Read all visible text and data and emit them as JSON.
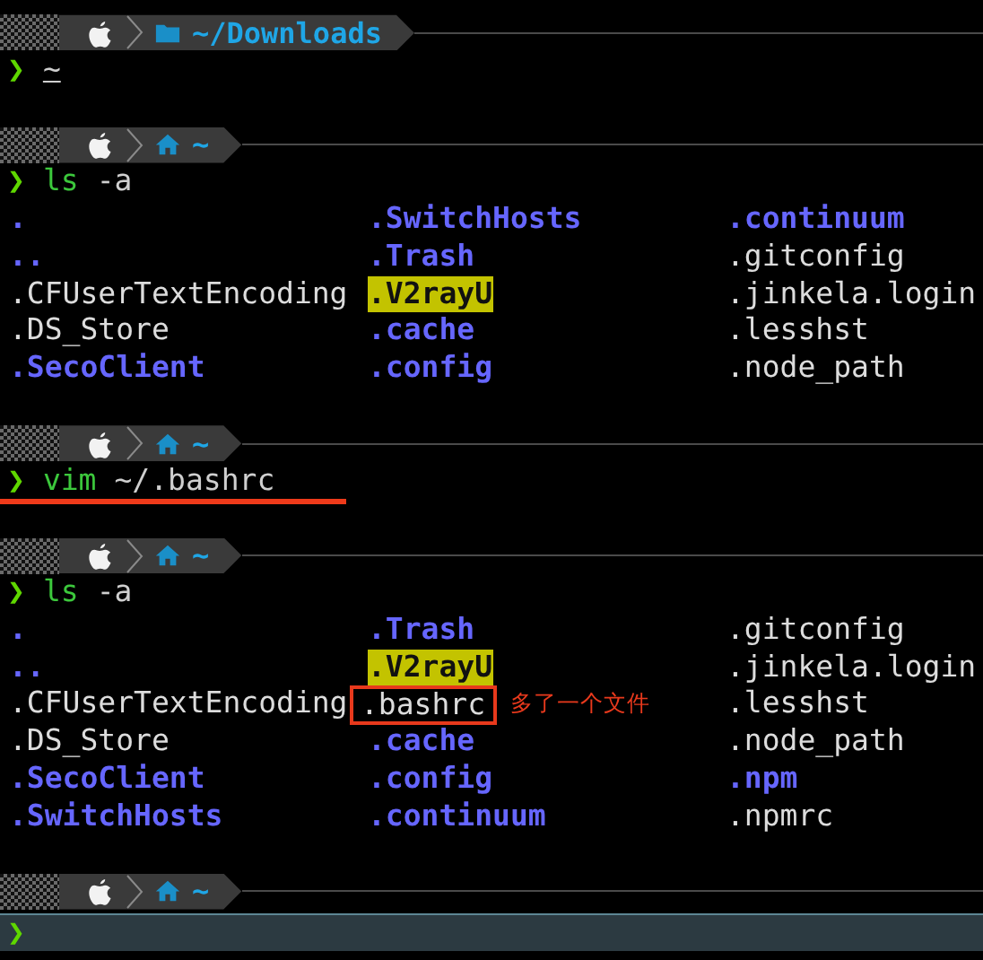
{
  "blocks": [
    {
      "kind": "prompt",
      "location": {
        "kind": "folder",
        "path": "~/Downloads"
      }
    },
    {
      "kind": "input",
      "symbol": "❯",
      "args": "~",
      "underlined": true,
      "annotated": false,
      "active": false
    },
    {
      "kind": "blank"
    },
    {
      "kind": "prompt",
      "location": {
        "kind": "home",
        "path": "~"
      }
    },
    {
      "kind": "input",
      "symbol": "❯",
      "command": "ls",
      "args": "-a",
      "underlined": false,
      "annotated": false,
      "active": false
    },
    {
      "kind": "listing",
      "rows": [
        [
          {
            "name": ".",
            "kind": "dir"
          },
          {
            "name": ".SwitchHosts",
            "kind": "dir"
          },
          {
            "name": ".continuum",
            "kind": "dir"
          }
        ],
        [
          {
            "name": "..",
            "kind": "dir"
          },
          {
            "name": ".Trash",
            "kind": "dir"
          },
          {
            "name": ".gitconfig",
            "kind": "file"
          }
        ],
        [
          {
            "name": ".CFUserTextEncoding",
            "kind": "file"
          },
          {
            "name": ".V2rayU",
            "kind": "writable"
          },
          {
            "name": ".jinkela.login",
            "kind": "file"
          }
        ],
        [
          {
            "name": ".DS_Store",
            "kind": "file"
          },
          {
            "name": ".cache",
            "kind": "dir"
          },
          {
            "name": ".lesshst",
            "kind": "file"
          }
        ],
        [
          {
            "name": ".SecoClient",
            "kind": "dir"
          },
          {
            "name": ".config",
            "kind": "dir"
          },
          {
            "name": ".node_path",
            "kind": "file"
          }
        ]
      ]
    },
    {
      "kind": "blank"
    },
    {
      "kind": "prompt",
      "location": {
        "kind": "home",
        "path": "~"
      }
    },
    {
      "kind": "input",
      "symbol": "❯",
      "command": "vim",
      "args": "~/.bashrc",
      "underlined": false,
      "annotated": true,
      "active": false
    },
    {
      "kind": "blank"
    },
    {
      "kind": "prompt",
      "location": {
        "kind": "home",
        "path": "~"
      }
    },
    {
      "kind": "input",
      "symbol": "❯",
      "command": "ls",
      "args": "-a",
      "underlined": false,
      "annotated": false,
      "active": false
    },
    {
      "kind": "listing",
      "rows": [
        [
          {
            "name": ".",
            "kind": "dir"
          },
          {
            "name": ".Trash",
            "kind": "dir"
          },
          {
            "name": ".gitconfig",
            "kind": "file"
          }
        ],
        [
          {
            "name": "..",
            "kind": "dir"
          },
          {
            "name": ".V2rayU",
            "kind": "writable"
          },
          {
            "name": ".jinkela.login",
            "kind": "file"
          }
        ],
        [
          {
            "name": ".CFUserTextEncoding",
            "kind": "file"
          },
          {
            "name": ".bashrc",
            "kind": "file",
            "boxed": true,
            "note": "多了一个文件"
          },
          {
            "name": ".lesshst",
            "kind": "file"
          }
        ],
        [
          {
            "name": ".DS_Store",
            "kind": "file"
          },
          {
            "name": ".cache",
            "kind": "dir"
          },
          {
            "name": ".node_path",
            "kind": "file"
          }
        ],
        [
          {
            "name": ".SecoClient",
            "kind": "dir"
          },
          {
            "name": ".config",
            "kind": "dir"
          },
          {
            "name": ".npm",
            "kind": "dir"
          }
        ],
        [
          {
            "name": ".SwitchHosts",
            "kind": "dir"
          },
          {
            "name": ".continuum",
            "kind": "dir"
          },
          {
            "name": ".npmrc",
            "kind": "file"
          }
        ]
      ]
    },
    {
      "kind": "blank"
    },
    {
      "kind": "prompt",
      "location": {
        "kind": "home",
        "path": "~"
      }
    },
    {
      "kind": "input",
      "symbol": "❯",
      "annotated": false,
      "active": true
    }
  ]
}
